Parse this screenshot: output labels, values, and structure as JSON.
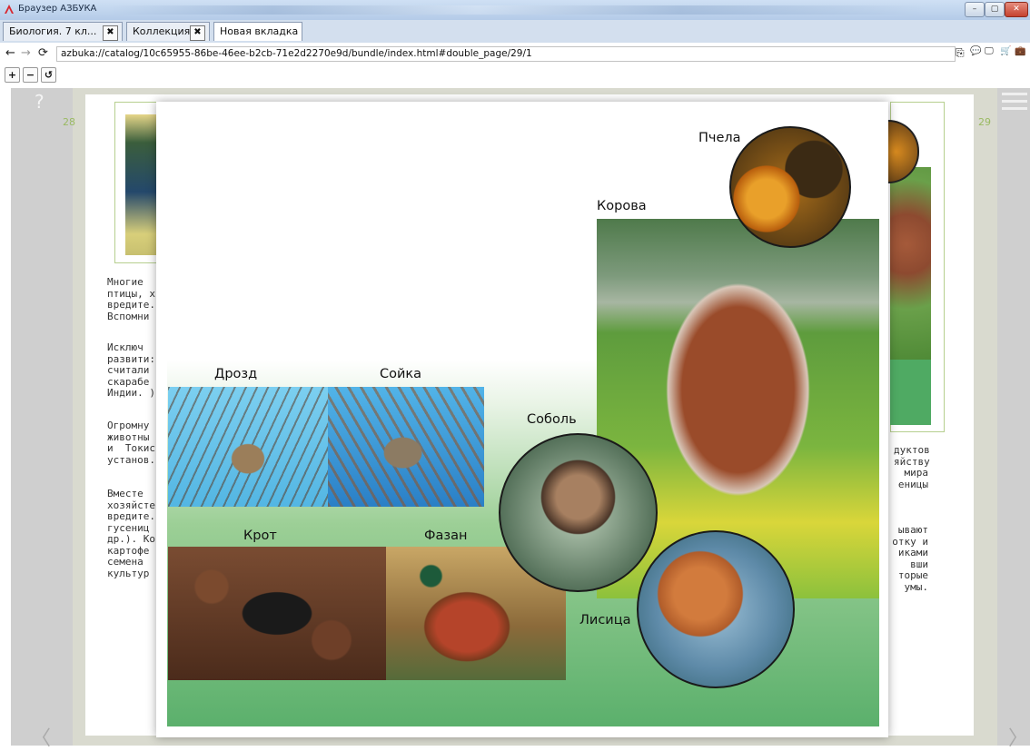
{
  "window": {
    "title": "Браузер АЗБУКА",
    "min_label": "–",
    "max_label": "▢",
    "close_label": "✕"
  },
  "tabs": [
    {
      "label": "Биология. 7 кл...",
      "closable": true
    },
    {
      "label": "Коллекция",
      "closable": true
    },
    {
      "label": "Новая вкладка",
      "closable": false
    }
  ],
  "tab_close_glyph": "✖",
  "nav": {
    "back_glyph": "←",
    "forward_glyph": "→",
    "reload_glyph": "⟳",
    "url": "azbuka://catalog/10c65955-86be-46ee-b2cb-71e2d2270e9d/bundle/index.html#double_page/29/1",
    "tools": [
      "⎘",
      "💬",
      "🖵",
      "🛒",
      "💼"
    ]
  },
  "zoom": {
    "in_glyph": "+",
    "out_glyph": "−",
    "reset_glyph": "↺"
  },
  "reader": {
    "help_glyph": "?",
    "prev_glyph": "〈",
    "next_glyph": "〉",
    "page_left": "28",
    "page_right": "29"
  },
  "left_text": {
    "p1": "Многие\nптицы, х\nвредите.\nВспомни",
    "p2": "Исключ\nразвити:\nсчитали\nскарабе\nИндии. )",
    "p3": "Огромну\nживотны\nи  Токис\nустанов.",
    "p4": "Вместе\nхозяйсте\nвредите.\nгусениц\nдр.). Ко\nкартофе\nсемена\nкультур"
  },
  "right_text": {
    "p1": "дуктов\nяйству\n мира\nеницы",
    "p2": "ывают\nотку и\nиками\n вши\nторые\nумы."
  },
  "popup": {
    "labels": {
      "bee": "Пчела",
      "cow": "Корова",
      "thrush": "Дрозд",
      "jay": "Сойка",
      "sable": "Соболь",
      "mole": "Крот",
      "pheasant": "Фазан",
      "fox": "Лисица"
    }
  }
}
